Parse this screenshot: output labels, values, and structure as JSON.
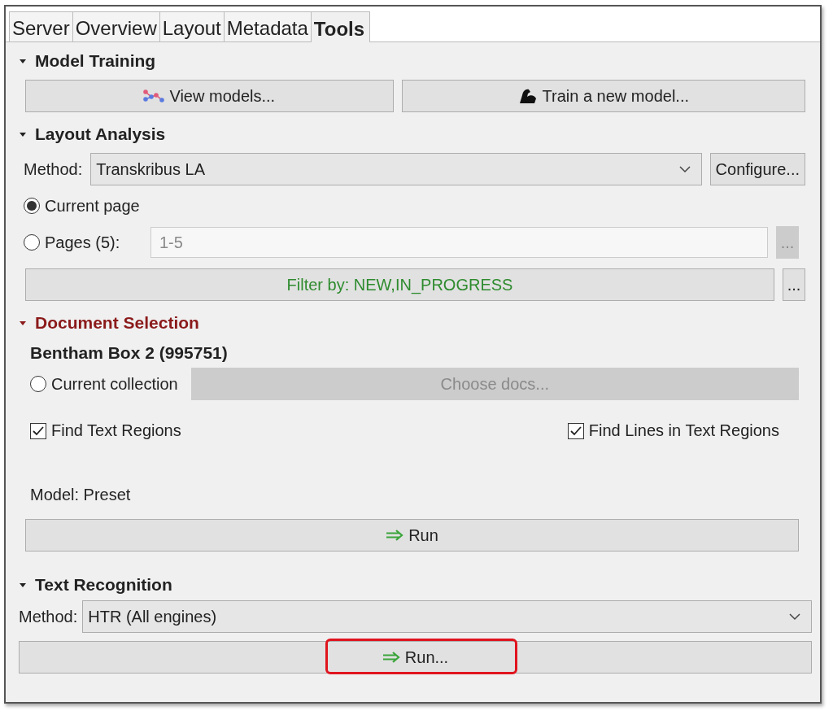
{
  "tabs": [
    {
      "label": "Server",
      "selected": false
    },
    {
      "label": "Overview",
      "selected": false
    },
    {
      "label": "Layout",
      "selected": false
    },
    {
      "label": "Metadata",
      "selected": false
    },
    {
      "label": "Tools",
      "selected": true
    }
  ],
  "model_training": {
    "title": "Model Training",
    "expanded": true,
    "highlighted": false,
    "view_button": "View models...",
    "train_button": "Train a new model..."
  },
  "layout_analysis": {
    "title": "Layout Analysis",
    "expanded": true,
    "highlighted": false,
    "method_label": "Method:",
    "method_value": "Transkribus LA",
    "configure_button": "Configure...",
    "scope": [
      {
        "label": "Current page",
        "selected": true
      },
      {
        "label": "Pages (5):",
        "selected": false
      }
    ],
    "pages_field": {
      "value": "1-5",
      "disabled": true
    },
    "pages_button": "...",
    "filter_button": "Filter by: NEW,IN_PROGRESS",
    "filter_more_button": "..."
  },
  "document_selection": {
    "title": "Document Selection",
    "expanded": true,
    "highlighted": true,
    "document": "Bentham Box 2 (995751)",
    "collection_option": {
      "label": "Current collection",
      "selected": false
    },
    "choose_docs_button": {
      "label": "Choose docs...",
      "disabled": true
    },
    "options": [
      {
        "label": "Find Text Regions",
        "checked": true
      },
      {
        "label": "Find Lines in Text Regions",
        "checked": true
      }
    ],
    "model": "Model: Preset",
    "run_button": "Run"
  },
  "text_recognition": {
    "title": "Text Recognition",
    "expanded": true,
    "highlighted": false,
    "method_label": "Method:",
    "method_value": "HTR (All engines)",
    "run_button": {
      "label": "Run...",
      "annotated": true
    }
  }
}
